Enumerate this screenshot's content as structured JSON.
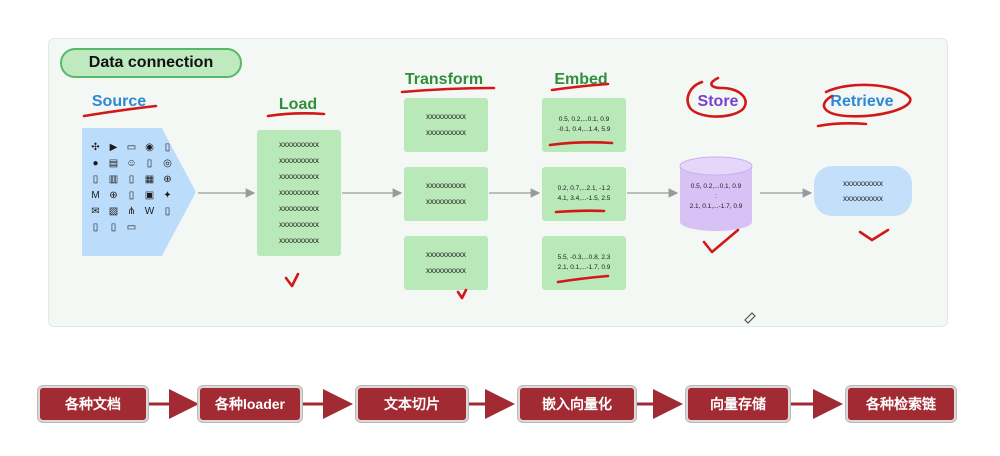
{
  "diagram": {
    "title": "Data connection",
    "headings": {
      "source": "Source",
      "load": "Load",
      "transform": "Transform",
      "embed": "Embed",
      "store": "Store",
      "retrieve": "Retrieve"
    },
    "load_box": [
      "xxxxxxxxxx",
      "xxxxxxxxxx",
      "xxxxxxxxxx",
      "xxxxxxxxxx",
      "xxxxxxxxxx",
      "xxxxxxxxxx",
      "xxxxxxxxxx"
    ],
    "transform_boxes": [
      [
        "xxxxxxxxxx",
        "xxxxxxxxxx"
      ],
      [
        "xxxxxxxxxx",
        "xxxxxxxxxx"
      ],
      [
        "xxxxxxxxxx",
        "xxxxxxxxxx"
      ]
    ],
    "embed_boxes": [
      [
        "0.5, 0.2,...0.1, 0.9",
        "-0.1, 0.4,...1.4, 5.9"
      ],
      [
        "0.2, 0.7,...2.1, -1.2",
        "4.1, 3.4,...-1.5, 2.5"
      ],
      [
        "5.5, -0.3,...0.8, 2.3",
        "2.1, 0.1,...-1.7, 0.9"
      ]
    ],
    "store_lines": [
      "0.5, 0.2,...0.1, 0.9",
      ":",
      "2.1, 0.1,...-1.7, 0.9"
    ],
    "retrieve_box": [
      "xxxxxxxxxx",
      "xxxxxxxxxx"
    ],
    "source_icons": [
      "slack-icon",
      "youtube-icon",
      "folder-icon",
      "discord-icon",
      "file-icon",
      "github-icon",
      "doc-icon",
      "robot-icon",
      "file-icon",
      "database-icon",
      "file-icon",
      "book-icon",
      "file-icon",
      "building-icon",
      "globe-icon",
      "markdown-icon",
      "globe-icon",
      "file-icon",
      "image-icon",
      "twitter-icon",
      "mail-icon",
      "pdf-icon",
      "sitemap-icon",
      "wikipedia-icon",
      "file-icon",
      "file-icon",
      "file-icon",
      "folder-icon"
    ]
  },
  "flow": {
    "steps": [
      "各种文档",
      "各种loader",
      "文本切片",
      "嵌入向量化",
      "向量存储",
      "各种检索链"
    ]
  },
  "colors": {
    "panel": "#f4f8f5",
    "green_box": "#b9e8b9",
    "blue_shape": "#bcdcfb",
    "store": "#d8c2f5",
    "flow_btn": "#a12a33",
    "annotation": "#d21818"
  }
}
